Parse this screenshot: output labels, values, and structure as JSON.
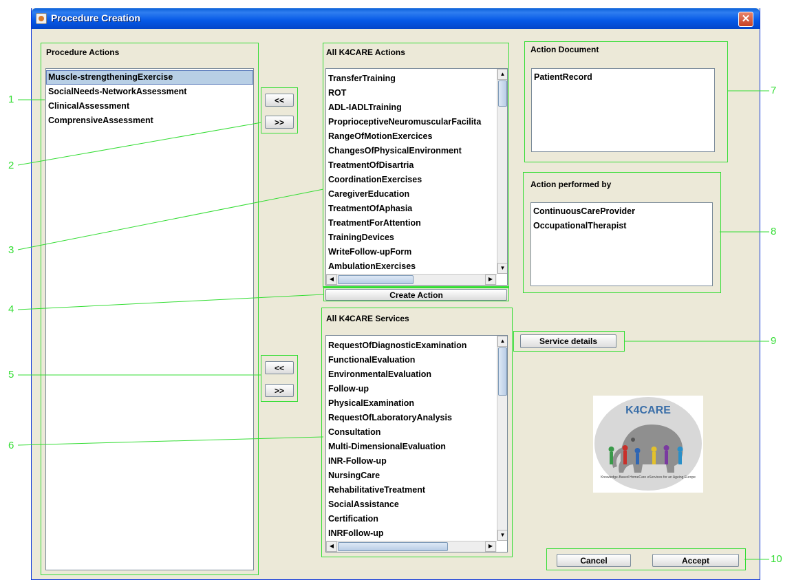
{
  "window": {
    "title": "Procedure Creation",
    "close_glyph": "✕"
  },
  "procedure_actions": {
    "label": "Procedure Actions",
    "items": [
      "Muscle-strengtheningExercise",
      "SocialNeeds-NetworkAssessment",
      "ClinicalAssessment",
      "ComprensiveAssessment"
    ],
    "selected_index": 0
  },
  "transfer_buttons": {
    "add_label": "<<",
    "remove_label": ">>"
  },
  "all_actions": {
    "label": "All K4CARE Actions",
    "items": [
      "TransferTraining",
      "ROT",
      "ADL-IADLTraining",
      "ProprioceptiveNeuromuscularFacilita",
      "RangeOfMotionExercices",
      "ChangesOfPhysicalEnvironment",
      "TreatmentOfDisartria",
      "CoordinationExercises",
      "CaregiverEducation",
      "TreatmentOfAphasia",
      "TreatmentForAttention",
      "TrainingDevices",
      "WriteFollow-upForm",
      "AmbulationExercises"
    ],
    "create_button": "Create Action"
  },
  "all_services": {
    "label": "All K4CARE Services",
    "items": [
      "RequestOfDiagnosticExamination",
      "FunctionalEvaluation",
      "EnvironmentalEvaluation",
      "Follow-up",
      "PhysicalExamination",
      "RequestOfLaboratoryAnalysis",
      "Consultation",
      "Multi-DimensionalEvaluation",
      "INR-Follow-up",
      "NursingCare",
      "RehabilitativeTreatment",
      "SocialAssistance",
      "Certification",
      "INRFollow-up"
    ]
  },
  "action_document": {
    "label": "Action Document",
    "items": [
      "PatientRecord"
    ]
  },
  "action_performed_by": {
    "label": "Action performed by",
    "items": [
      "ContinuousCareProvider",
      "OccupationalTherapist"
    ]
  },
  "service_details_button": "Service details",
  "logo": {
    "text": "K4CARE",
    "tagline": "Knowledge-Based HomeCare eServices for an Ageing Europe"
  },
  "footer": {
    "cancel_label": "Cancel",
    "accept_label": "Accept"
  },
  "callouts": [
    "1",
    "2",
    "3",
    "4",
    "5",
    "6",
    "7",
    "8",
    "9",
    "10"
  ],
  "scroll_glyphs": {
    "up": "▲",
    "down": "▼",
    "left": "◀",
    "right": "▶"
  },
  "colors": {
    "annotation_green": "#33dd33",
    "title_blue": "#0558e6",
    "selection": "#b8cfe5"
  }
}
